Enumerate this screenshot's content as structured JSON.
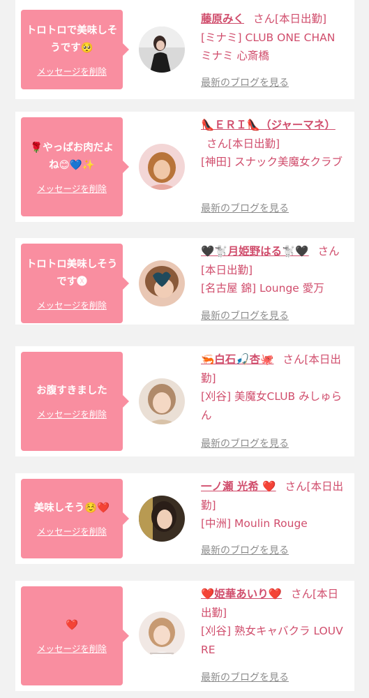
{
  "messages": [
    {
      "text": "トロトロで美味しそうです🥺",
      "delete_label": "メッセージを削除",
      "name": "藤原みく",
      "suffix": "さん[本日出勤]",
      "shop": "[ミナミ] CLUB ONE CHAN ミナミ 心斎橋",
      "blog_label": "最新のブログを見る"
    },
    {
      "text": "🌹やっぱお肉だよね😊💙✨",
      "delete_label": "メッセージを削除",
      "name": "👠ＥＲＩ👠（ジャーマネ）",
      "suffix": "さん[本日出勤]",
      "shop": "[神田] スナック美魔女クラブ",
      "blog_label": "最新のブログを見る"
    },
    {
      "text": "トロトロ美味しそうです🅧",
      "delete_label": "メッセージを削除",
      "name": "🖤🐩月姫野はる🐩🖤",
      "suffix": "さん[本日出勤]",
      "shop": "[名古屋 錦] Lounge 愛万",
      "blog_label": "最新のブログを見る"
    },
    {
      "text": "お腹すきました",
      "delete_label": "メッセージを削除",
      "name": "🦐白石🎣杏🐙",
      "suffix": "さん[本日出勤]",
      "shop": "[刈谷] 美魔女CLUB みしゅらん",
      "blog_label": "最新のブログを見る"
    },
    {
      "text": "美味しそう☺️❤️",
      "delete_label": "メッセージを削除",
      "name": "一ノ瀬 光希 ❤️",
      "suffix": "さん[本日出勤]",
      "shop": "[中洲] Moulin Rouge",
      "blog_label": "最新のブログを見る"
    },
    {
      "text": "❤️",
      "delete_label": "メッセージを削除",
      "name": "❤️姫華あいり❤️",
      "suffix": "さん[本日出勤]",
      "shop": "[刈谷] 熟女キャバクラ LOUVRE",
      "blog_label": "最新のブログを見る"
    }
  ]
}
